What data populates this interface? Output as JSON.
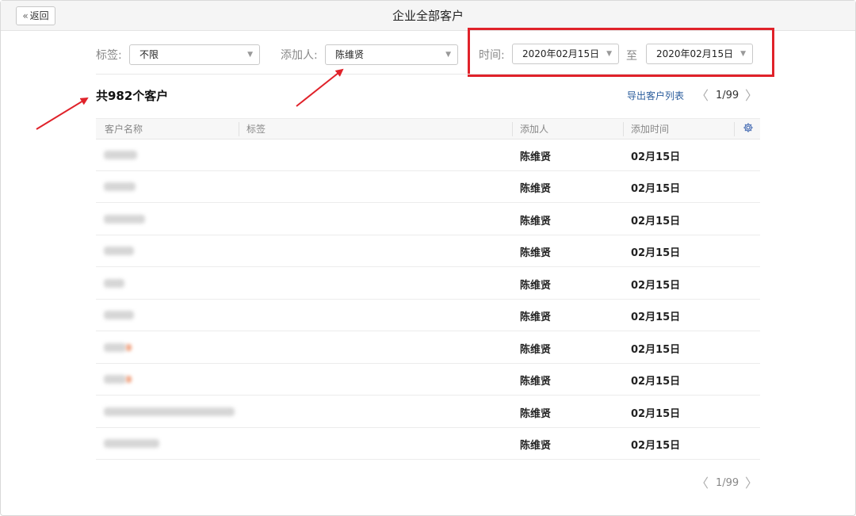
{
  "header": {
    "back_label": "返回",
    "back_chevron": "«",
    "title": "企业全部客户"
  },
  "filters": {
    "tag_label": "标签:",
    "tag_value": "不限",
    "adder_label": "添加人:",
    "adder_value": "陈维贤",
    "time_label": "时间:",
    "start_date": "2020年02月15日",
    "to_label": "至",
    "end_date": "2020年02月15日",
    "dropdown_arrow": "▼"
  },
  "summary": {
    "total_label": "共982个客户",
    "export_label": "导出客户列表",
    "page_indicator": "1/99",
    "prev_arrow": "〈",
    "next_arrow": "〉"
  },
  "table": {
    "columns": [
      "客户名称",
      "标签",
      "添加人",
      "添加时间"
    ],
    "rows": [
      {
        "adder": "陈维贤",
        "time": "02月15日"
      },
      {
        "adder": "陈维贤",
        "time": "02月15日"
      },
      {
        "adder": "陈维贤",
        "time": "02月15日"
      },
      {
        "adder": "陈维贤",
        "time": "02月15日"
      },
      {
        "adder": "陈维贤",
        "time": "02月15日"
      },
      {
        "adder": "陈维贤",
        "time": "02月15日"
      },
      {
        "adder": "陈维贤",
        "time": "02月15日"
      },
      {
        "adder": "陈维贤",
        "time": "02月15日"
      },
      {
        "adder": "陈维贤",
        "time": "02月15日"
      },
      {
        "adder": "陈维贤",
        "time": "02月15日"
      }
    ]
  },
  "footer": {
    "page_indicator": "1/99"
  },
  "colors": {
    "highlight": "#e0222a",
    "link": "#2b5d9c",
    "gear": "#4a6fb5"
  }
}
